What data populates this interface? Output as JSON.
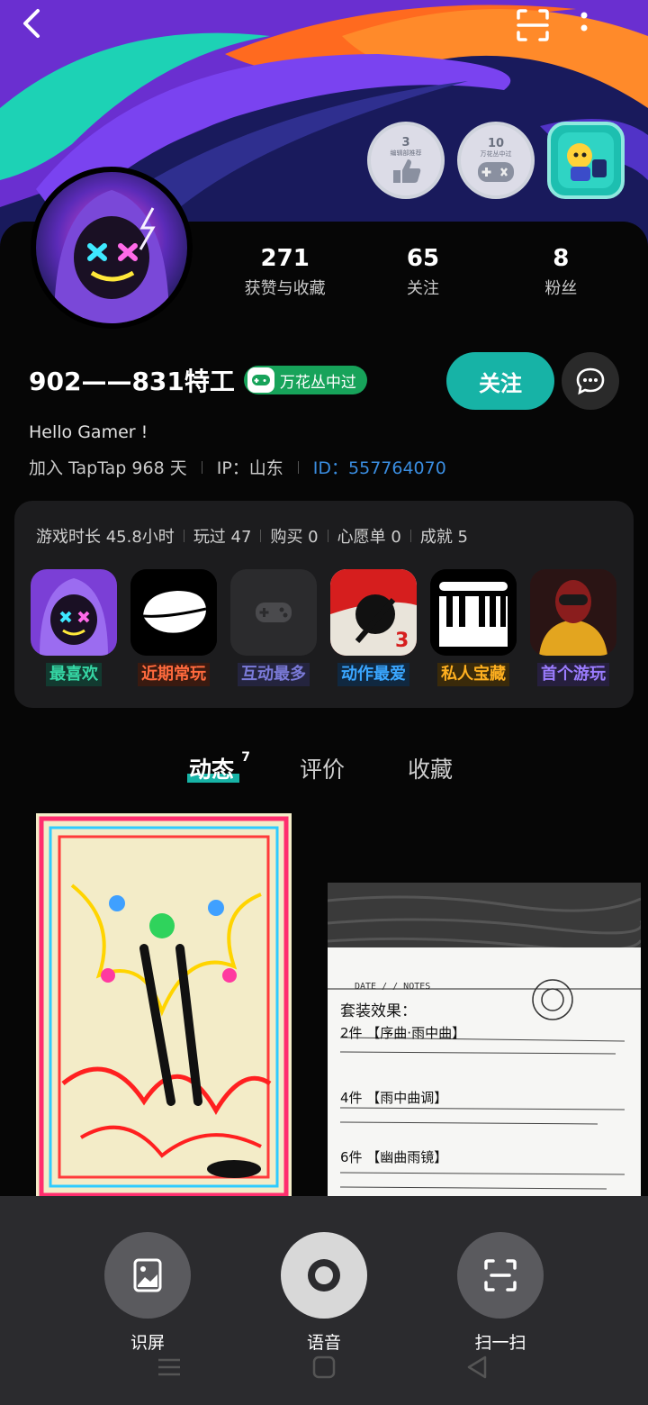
{
  "topbar": {
    "back_icon": "chevron-left-icon",
    "scan_icon": "scan-icon",
    "more_icon": "more-vertical-icon"
  },
  "badges": [
    {
      "num": "3",
      "sub": "编辑部推荐",
      "icon": "thumbs-up-icon"
    },
    {
      "num": "10",
      "sub": "万花丛中过",
      "icon": "gamepad-icon"
    },
    {
      "num": "",
      "sub": "",
      "icon": "character-badge-icon"
    }
  ],
  "stats": [
    {
      "value": "271",
      "label": "获赞与收藏"
    },
    {
      "value": "65",
      "label": "关注"
    },
    {
      "value": "8",
      "label": "粉丝"
    }
  ],
  "profile": {
    "name": "902——831特工",
    "tag": "万花丛中过",
    "follow_label": "关注",
    "bio": "Hello Gamer !",
    "joined": "加入 TapTap 968 天",
    "ip": "IP：山东",
    "id": "ID：557764070"
  },
  "games": {
    "stats": [
      "游戏时长 45.8小时",
      "玩过 47",
      "购买 0",
      "心愿单 0",
      "成就 5"
    ],
    "items": [
      {
        "label": "最喜欢",
        "color": "#35d6a4"
      },
      {
        "label": "近期常玩",
        "color": "#ff6a3d"
      },
      {
        "label": "互动最多",
        "color": "#7a7ad8"
      },
      {
        "label": "动作最爱",
        "color": "#3aa6ff"
      },
      {
        "label": "私人宝藏",
        "color": "#ffb020"
      },
      {
        "label": "首个游玩",
        "color": "#9b7cff"
      }
    ]
  },
  "tabs": [
    {
      "label": "动态",
      "count": "7"
    },
    {
      "label": "评价"
    },
    {
      "label": "收藏"
    }
  ],
  "feed": {
    "note_lines": [
      "套装效果：",
      "2件 【序曲·雨中曲】",
      "4件 【雨中曲调】",
      "6件 【幽曲雨镜】"
    ],
    "note_header": "DATE  /  /   NOTES"
  },
  "sheet": {
    "actions": [
      {
        "label": "识屏",
        "icon": "image-icon"
      },
      {
        "label": "语音",
        "icon": "record-icon"
      },
      {
        "label": "扫一扫",
        "icon": "scan-icon"
      }
    ]
  },
  "colors": {
    "accent": "#17b3a6",
    "id_link": "#3a8de0",
    "tag_green": "#17a35a"
  }
}
